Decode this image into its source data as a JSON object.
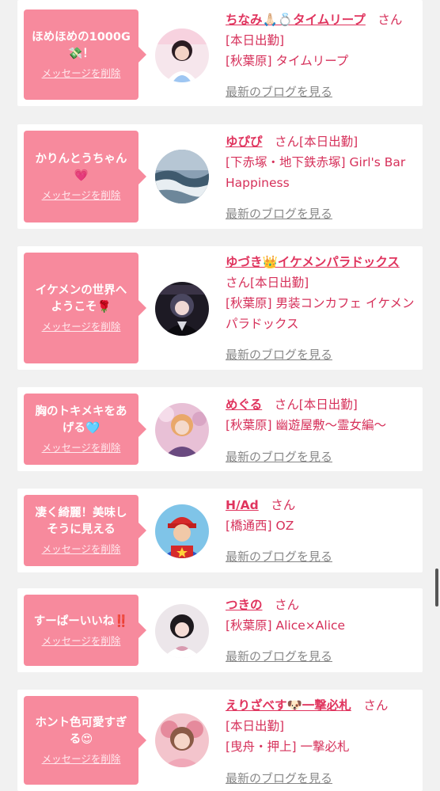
{
  "delete_label": "メッセージを削除",
  "blog_label": "最新のブログを見る",
  "san": "さん",
  "colors": {
    "bubble": "#f78a9d",
    "accent": "#e0345e",
    "card": "#ffffff",
    "background": "#f1f1f1"
  },
  "items": [
    {
      "message": "ほめほめの1000G💸！",
      "name": "ちなみ🙏🏻💍タイムリープ",
      "info_line1": "[本日出勤]",
      "info_line2": "[秋葉原] タイムリープ",
      "avatar_icon": "avatar-photo-girl-light"
    },
    {
      "message": "かりんとうちゃん💗",
      "name": "ゆぴぴ",
      "info_line1": "[本日出勤]",
      "info_line2": "[下赤塚・地下鉄赤塚] Girl's Bar Happiness",
      "avatar_icon": "avatar-photo-wave"
    },
    {
      "message": "イケメンの世界へようこそ🌹",
      "name": "ゆづき👑イケメンパラドックス",
      "info_line1": "[本日出勤]",
      "info_line2": "[秋葉原] 男装コンカフェ イケメンパラドックス",
      "avatar_icon": "avatar-photo-dark"
    },
    {
      "message": "胸のトキメキをあげる🩵",
      "name": "めぐる",
      "info_line1": "[本日出勤]",
      "info_line2": "[秋葉原] 幽遊屋敷〜霊女編〜",
      "avatar_icon": "avatar-photo-pink"
    },
    {
      "message": "凄く綺麗！美味しそうに見える",
      "name": "H/Ad",
      "info_line1": "",
      "info_line2": "[橋通西] OZ",
      "avatar_icon": "avatar-photo-mario"
    },
    {
      "message": "すーぱーいいね‼️",
      "name": "つきの",
      "info_line1": "",
      "info_line2": "[秋葉原] Alice×Alice",
      "avatar_icon": "avatar-photo-girl-white"
    },
    {
      "message": "ホント色可愛すぎる😍",
      "name": "えりざべす🐶一撃必札",
      "info_line1": "[本日出勤]",
      "info_line2": "[曳舟・押上] 一撃必札",
      "avatar_icon": "avatar-photo-girl-pink"
    }
  ]
}
